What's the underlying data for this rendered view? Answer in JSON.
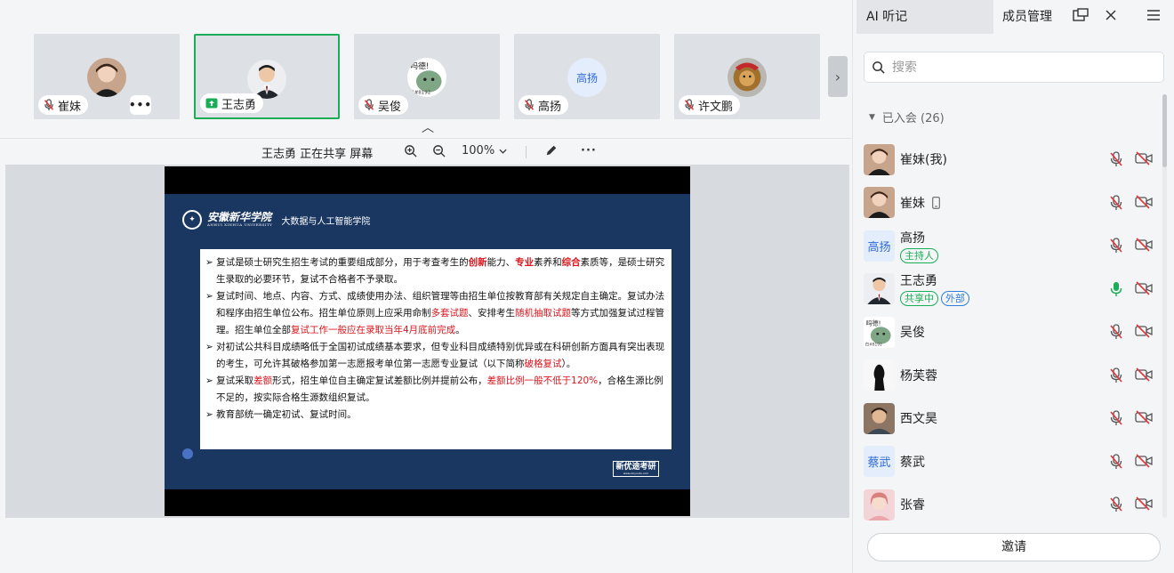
{
  "thumbnails": [
    {
      "name": "崔妹",
      "mic": "muted",
      "avatar": "photo-girl",
      "has_more": true
    },
    {
      "name": "王志勇",
      "mic": "sharing",
      "avatar": "photo-man",
      "active": true
    },
    {
      "name": "吴俊",
      "mic": "muted",
      "avatar": "cartoon-cactus"
    },
    {
      "name": "高扬",
      "mic": "muted",
      "avatar_text": "高扬"
    },
    {
      "name": "许文鹏",
      "mic": "muted",
      "avatar": "photo-lion"
    }
  ],
  "share_bar": {
    "presenter_text": "王志勇  正在共享 屏幕",
    "zoom": "100%"
  },
  "slide": {
    "school_name": "安徽新华学院",
    "school_english": "ANHUI XINHUA UNIVERSITY",
    "department": "大数据与人工智能学院",
    "brand": "新优途考研",
    "brand_sub": "www.xinyoutu.com",
    "bullets": [
      [
        {
          "t": "➢ 复试是硕士研究生招生考试的重要组成部分，用于考查考生的"
        },
        {
          "t": "创新",
          "s": "rb"
        },
        {
          "t": "能力、"
        },
        {
          "t": "专业",
          "s": "rb"
        },
        {
          "t": "素养和"
        },
        {
          "t": "综合",
          "s": "rb"
        },
        {
          "t": "素质等，是硕士研究生录取的必要环节，复试不合格者不予录取。"
        }
      ],
      [
        {
          "t": "➢ 复试时间、地点、内容、方式、成绩使用办法、组织管理等由招生单位按教育部有关规定自主确定。复试办法和程序由招生单位公布。招生单位原则上应采用命制"
        },
        {
          "t": "多套试题",
          "s": "r"
        },
        {
          "t": "、安排考生"
        },
        {
          "t": "随机抽取试题",
          "s": "r"
        },
        {
          "t": "等方式加强复试过程管理。招生单位全部"
        },
        {
          "t": "复试工作一般应在录取当年4月底前完成",
          "s": "r"
        },
        {
          "t": "。"
        }
      ],
      [
        {
          "t": "➢ 对初试公共科目成绩略低于全国初试成绩基本要求，但专业科目成绩特别优异或在科研创新方面具有突出表现的考生，可允许其破格参加第一志愿报考单位第一志愿专业复试（以下简称"
        },
        {
          "t": "破格复试",
          "s": "r"
        },
        {
          "t": "）。"
        }
      ],
      [
        {
          "t": "➢ 复试采取"
        },
        {
          "t": "差额",
          "s": "r"
        },
        {
          "t": "形式，招生单位自主确定复试差额比例并提前公布，"
        },
        {
          "t": "差额比例一般不低于120%",
          "s": "r"
        },
        {
          "t": "，合格生源比例不足的，按实际合格生源数组织复试。"
        }
      ],
      [
        {
          "t": "➢ 教育部统一确定初试、复试时间。"
        }
      ]
    ]
  },
  "panel": {
    "tab_ai": "AI 听记",
    "tab_members": "成员管理",
    "search_placeholder": "搜索",
    "group_label": "已入会 (26)",
    "invite_label": "邀请"
  },
  "members": [
    {
      "name": "崔妹(我)",
      "avatar": "photo-girl",
      "mic": "muted",
      "cam": "off"
    },
    {
      "name": "崔妹",
      "avatar": "photo-girl",
      "device": "phone",
      "mic": "muted",
      "cam": "off"
    },
    {
      "name": "高扬",
      "avatar_text": "高扬",
      "tags": [
        {
          "label": "主持人",
          "kind": "host"
        }
      ],
      "mic": "muted",
      "cam": "off"
    },
    {
      "name": "王志勇",
      "avatar": "photo-man",
      "tags": [
        {
          "label": "共享中",
          "kind": "share"
        },
        {
          "label": "外部",
          "kind": "ext"
        }
      ],
      "mic": "on",
      "cam": "off"
    },
    {
      "name": "吴俊",
      "avatar": "cartoon-cactus",
      "mic": "muted",
      "cam": "off"
    },
    {
      "name": "杨芙蓉",
      "avatar": "silhouette",
      "mic": "muted",
      "cam": "off"
    },
    {
      "name": "西文昊",
      "avatar": "photo-boy",
      "mic": "muted",
      "cam": "off"
    },
    {
      "name": "蔡武",
      "avatar_text": "蔡武",
      "mic": "muted",
      "cam": "off"
    },
    {
      "name": "张睿",
      "avatar": "photo-woman",
      "mic": "muted",
      "cam": "off"
    }
  ],
  "colors": {
    "accent_green": "#1aad57",
    "muted_red": "#e0353b",
    "slide_navy": "#1a3761",
    "link_blue": "#2f7ed8"
  }
}
